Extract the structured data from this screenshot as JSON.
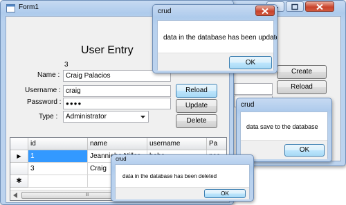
{
  "form": {
    "title": "Form1",
    "heading": "User Entry",
    "id_value": "3",
    "name_label": "Name :",
    "name_value": "Craig Palacios",
    "username_label": "Username :",
    "username_value": "craig",
    "password_label": "Password :",
    "password_value": "●●●●",
    "type_label": "Type :",
    "type_value": "Administrator",
    "buttons": {
      "reload": "Reload",
      "update": "Update",
      "delete": "Delete"
    }
  },
  "grid": {
    "columns": [
      "id",
      "name",
      "username",
      "Pa"
    ],
    "rows": [
      {
        "marker": "▶",
        "id": "1",
        "name": "Jeanniebe Nillos",
        "username": "bebe",
        "pa": "pas"
      },
      {
        "marker": "",
        "id": "3",
        "name": "Craig",
        "username": "",
        "pa": ""
      },
      {
        "marker": "✱",
        "id": "",
        "name": "",
        "username": "",
        "pa": ""
      }
    ],
    "scroll_thumb": "III"
  },
  "back_window": {
    "buttons": {
      "create": "Create",
      "reload": "Reload"
    }
  },
  "dialogs": {
    "updated": {
      "title": "crud",
      "message": "data in the database has been updated",
      "ok": "OK"
    },
    "saved": {
      "title": "crud",
      "message": "data save to the database",
      "ok": "OK"
    },
    "deleted": {
      "title": "crud",
      "message": "data in the database has been deleted",
      "ok": "OK"
    }
  },
  "colors": {
    "selection": "#3399ff",
    "window_frame": "#aecbec",
    "close_button": "#c8432c"
  }
}
